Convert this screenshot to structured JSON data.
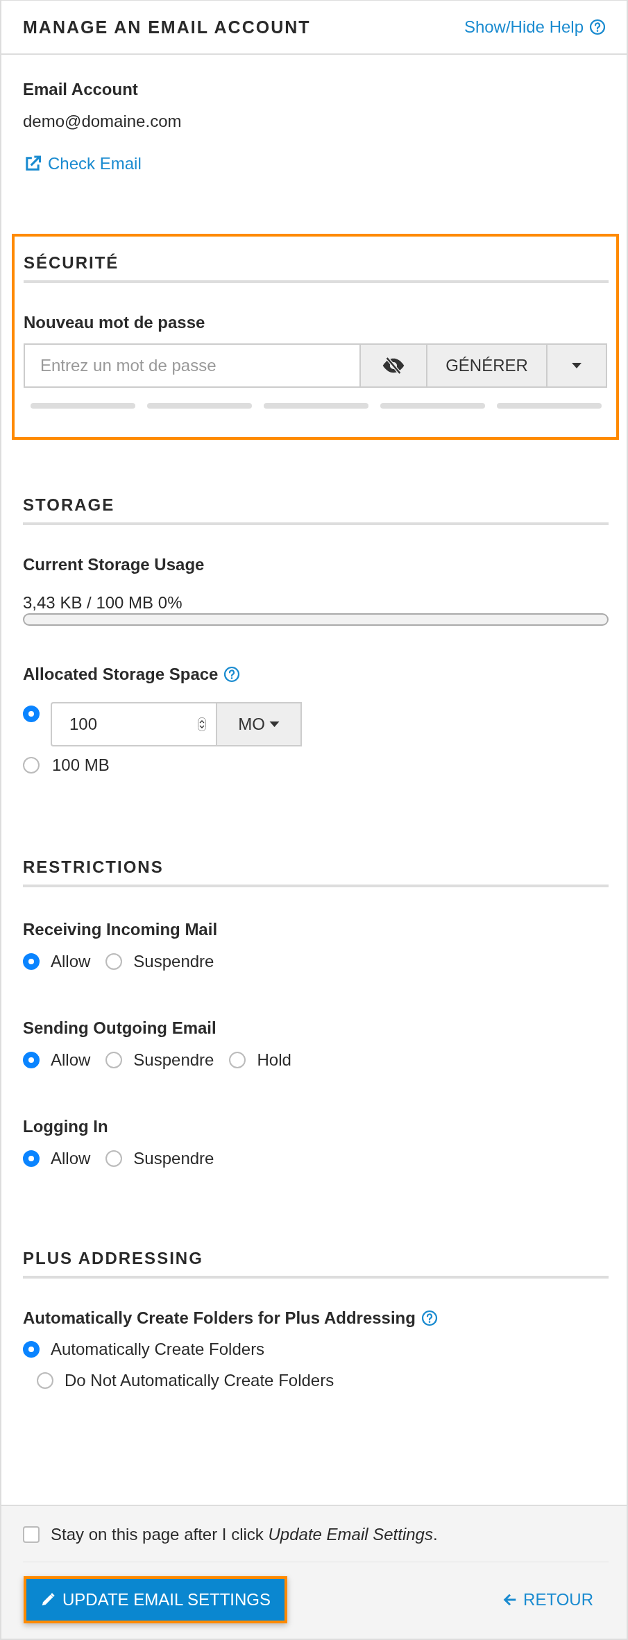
{
  "header": {
    "title": "MANAGE AN EMAIL ACCOUNT",
    "help_link": "Show/Hide Help"
  },
  "account": {
    "label": "Email Account",
    "value": "demo@domaine.com",
    "check_link": "Check Email"
  },
  "security": {
    "title": "SÉCURITÉ",
    "highlighted": true,
    "password_label": "Nouveau mot de passe",
    "placeholder": "Entrez un mot de passe",
    "generate_button": "GÉNÉRER",
    "strength_segments": [
      {
        "on": false
      },
      {
        "on": false
      },
      {
        "on": false
      },
      {
        "on": false
      },
      {
        "on": false
      }
    ]
  },
  "storage": {
    "title": "STORAGE",
    "usage_label": "Current Storage Usage",
    "usage_reading": "3,43 KB / 100 MB 0%",
    "usage": {
      "level": 0
    },
    "allocated_label": "Allocated Storage Space",
    "options": [
      {
        "kind": "custom",
        "selected": true,
        "value": "100",
        "unit": "MO"
      },
      {
        "kind": "fixed",
        "selected": false,
        "label": "100 MB"
      }
    ]
  },
  "restrictions": {
    "title": "RESTRICTIONS",
    "groups": [
      {
        "label": "Receiving Incoming Mail",
        "options": [
          {
            "label": "Allow",
            "selected": true
          },
          {
            "label": "Suspendre",
            "selected": false
          }
        ]
      },
      {
        "label": "Sending Outgoing Email",
        "options": [
          {
            "label": "Allow",
            "selected": true
          },
          {
            "label": "Suspendre",
            "selected": false
          },
          {
            "label": "Hold",
            "selected": false
          }
        ]
      },
      {
        "label": "Logging In",
        "options": [
          {
            "label": "Allow",
            "selected": true
          },
          {
            "label": "Suspendre",
            "selected": false
          }
        ]
      }
    ]
  },
  "plus_addressing": {
    "title": "PLUS ADDRESSING",
    "label": "Automatically Create Folders for Plus Addressing",
    "options": [
      {
        "label": "Automatically Create Folders",
        "selected": true
      },
      {
        "label": "Do Not Automatically Create Folders",
        "selected": false
      }
    ]
  },
  "footer": {
    "stay_checkbox": {
      "label": "Stay on this page after I click *Update Email Settings*.",
      "checked": false
    },
    "submit_button": "UPDATE EMAIL SETTINGS",
    "submit_highlighted": true,
    "back_link": "RETOUR"
  }
}
